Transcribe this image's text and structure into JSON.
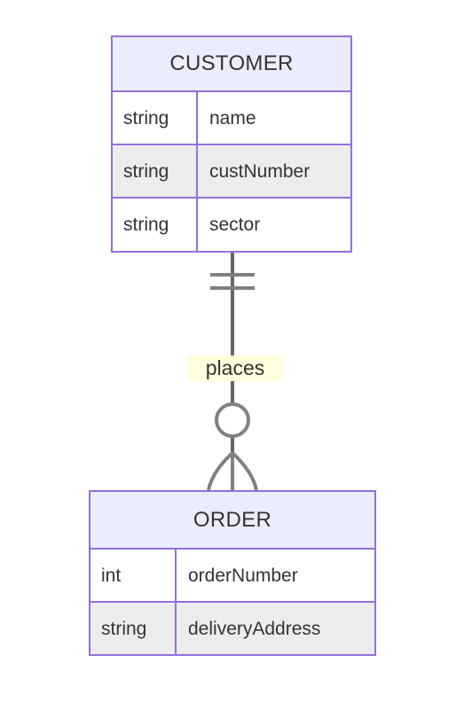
{
  "diagram": {
    "type": "entity-relationship-diagram",
    "notation": "crow's foot",
    "background_color": "#ffffff",
    "stroke_color": "#666666",
    "entity_border_color": "#9370db",
    "entity_header_fill": "#ececff",
    "entity_row_fill_even": "#ffffff",
    "entity_row_fill_odd": "#ececec",
    "label_background_color": "#ffffde",
    "text_color": "#333333"
  },
  "entities": [
    {
      "id": "customer",
      "name": "CUSTOMER",
      "attributes": [
        {
          "type": "string",
          "name": "name"
        },
        {
          "type": "string",
          "name": "custNumber"
        },
        {
          "type": "string",
          "name": "sector"
        }
      ]
    },
    {
      "id": "order",
      "name": "ORDER",
      "attributes": [
        {
          "type": "int",
          "name": "orderNumber"
        },
        {
          "type": "string",
          "name": "deliveryAddress"
        }
      ]
    }
  ],
  "relationships": [
    {
      "id": "customer-places-order",
      "label": "places",
      "from_entity": "CUSTOMER",
      "to_entity": "ORDER",
      "from_cardinality": "exactly one",
      "to_cardinality": "zero or many",
      "from_marker": "double-bar",
      "to_marker": "circle-crowsfoot"
    }
  ]
}
